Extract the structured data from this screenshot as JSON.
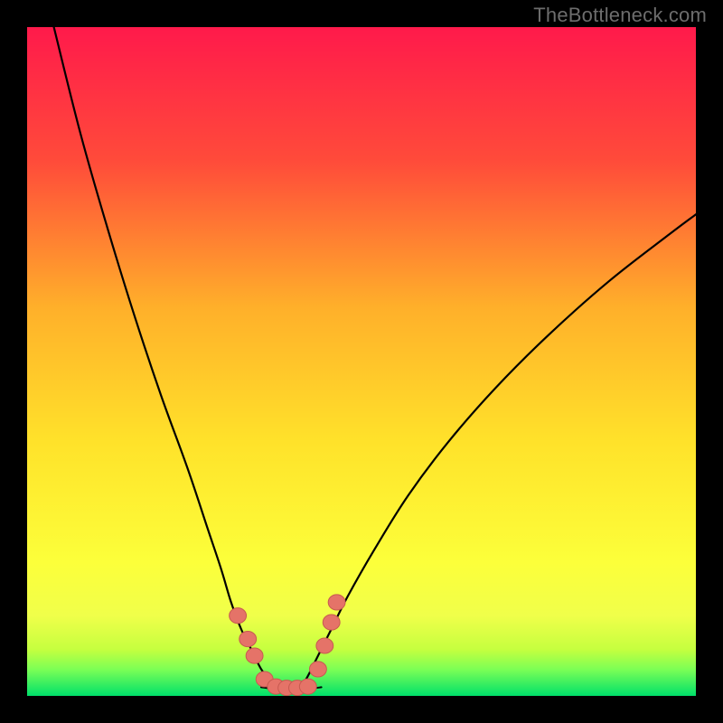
{
  "watermark": "TheBottleneck.com",
  "colors": {
    "frame": "#000000",
    "gradient_top": "#ff1a4b",
    "gradient_mid_upper": "#ff7a2a",
    "gradient_mid": "#ffd400",
    "gradient_lower": "#f6ff3a",
    "gradient_band": "#c6ff3f",
    "gradient_bottom": "#00e06a",
    "curve": "#000000",
    "marker_fill": "#e57368",
    "marker_stroke": "#c75a50"
  },
  "chart_data": {
    "type": "line",
    "title": "",
    "xlabel": "",
    "ylabel": "",
    "xlim": [
      0,
      100
    ],
    "ylim": [
      0,
      100
    ],
    "grid": false,
    "series": [
      {
        "name": "left-curve",
        "x": [
          4,
          8,
          12,
          16,
          20,
          24,
          27,
          29,
          30.5,
          32,
          33.5,
          35,
          36.5,
          37.5
        ],
        "y": [
          100,
          84,
          70,
          57,
          45,
          34,
          25,
          19,
          14,
          10,
          7,
          4,
          2.2,
          1.3
        ]
      },
      {
        "name": "right-curve",
        "x": [
          41,
          42,
          43.5,
          45.5,
          48,
          52,
          57,
          63,
          70,
          78,
          87,
          96,
          100
        ],
        "y": [
          1.3,
          3,
          6,
          10,
          15,
          22,
          30,
          38,
          46,
          54,
          62,
          69,
          72
        ]
      },
      {
        "name": "valley-floor",
        "x": [
          35,
          36.5,
          38,
          39.5,
          41,
          42.5,
          44
        ],
        "y": [
          1.3,
          1.1,
          1.0,
          1.0,
          1.0,
          1.1,
          1.3
        ]
      }
    ],
    "markers": {
      "name": "highlight-points",
      "points": [
        {
          "x": 31.5,
          "y": 12
        },
        {
          "x": 33.0,
          "y": 8.5
        },
        {
          "x": 34.0,
          "y": 6.0
        },
        {
          "x": 35.5,
          "y": 2.5
        },
        {
          "x": 37.2,
          "y": 1.4
        },
        {
          "x": 38.8,
          "y": 1.2
        },
        {
          "x": 40.4,
          "y": 1.2
        },
        {
          "x": 42.0,
          "y": 1.4
        },
        {
          "x": 43.5,
          "y": 4.0
        },
        {
          "x": 44.5,
          "y": 7.5
        },
        {
          "x": 45.5,
          "y": 11.0
        },
        {
          "x": 46.3,
          "y": 14.0
        }
      ]
    }
  }
}
